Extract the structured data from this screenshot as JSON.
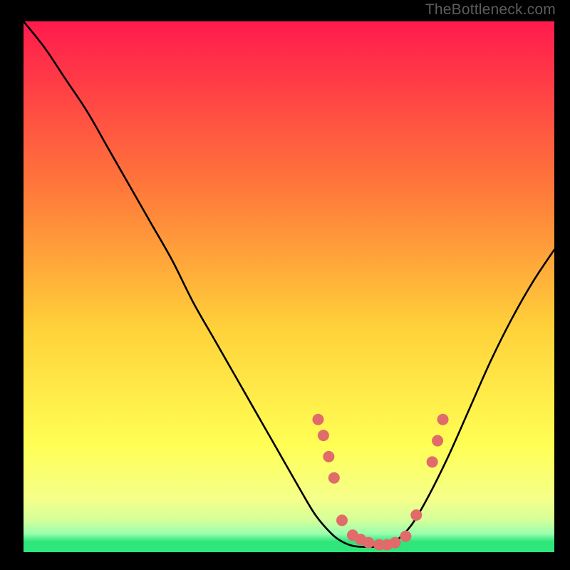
{
  "watermark": "TheBottleneck.com",
  "colors": {
    "gradient_top": "#ff1a4d",
    "gradient_mid1": "#ff7a3a",
    "gradient_mid2": "#ffd23a",
    "gradient_mid3": "#ffff55",
    "gradient_bottom": "#2fe67b",
    "curve": "#000000",
    "dots": "#e16a6a",
    "frame": "#000000"
  },
  "chart_data": {
    "type": "line",
    "title": "",
    "xlabel": "",
    "ylabel": "",
    "xlim": [
      0,
      100
    ],
    "ylim": [
      0,
      100
    ],
    "grid": false,
    "legend": false,
    "series": [
      {
        "name": "bottleneck-curve",
        "x": [
          0,
          4,
          8,
          12,
          16,
          20,
          24,
          28,
          32,
          36,
          40,
          44,
          48,
          52,
          55,
          58,
          60,
          62,
          64,
          66,
          68,
          70,
          73,
          76,
          80,
          84,
          88,
          92,
          96,
          100
        ],
        "y": [
          100,
          95,
          89,
          83,
          76,
          69,
          62,
          55,
          47,
          40,
          33,
          26,
          19,
          12,
          7,
          3.5,
          2,
          1.2,
          1,
          1,
          1.2,
          2,
          5,
          10,
          18,
          27,
          36,
          44,
          51,
          57
        ]
      }
    ],
    "dots": {
      "name": "highlight-dots",
      "x": [
        55.5,
        56.5,
        57.5,
        58.5,
        60,
        62,
        63.5,
        65,
        67,
        68.5,
        70,
        72,
        74,
        77,
        78,
        79
      ],
      "y": [
        25,
        22,
        18,
        14,
        6,
        3.2,
        2.4,
        1.8,
        1.4,
        1.4,
        1.8,
        3,
        7,
        17,
        21,
        25
      ]
    }
  }
}
